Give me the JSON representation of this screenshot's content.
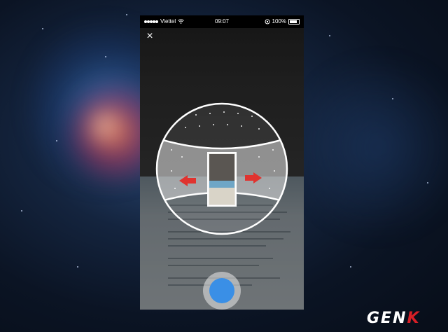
{
  "status_bar": {
    "carrier": "Viettel",
    "time": "09:07",
    "battery_percent": "100%",
    "icons": [
      "signal-dots-icon",
      "wifi-icon",
      "rotation-lock-icon",
      "battery-icon"
    ]
  },
  "camera": {
    "close_icon": "×",
    "mode": "panorama",
    "pan_arrows": [
      "left-arrow-icon",
      "right-arrow-icon"
    ],
    "colors": {
      "arrow": "#e0332f",
      "shutter": "#3a8fe6"
    }
  },
  "watermark": {
    "logo_main": "GEN",
    "logo_accent": "K"
  }
}
